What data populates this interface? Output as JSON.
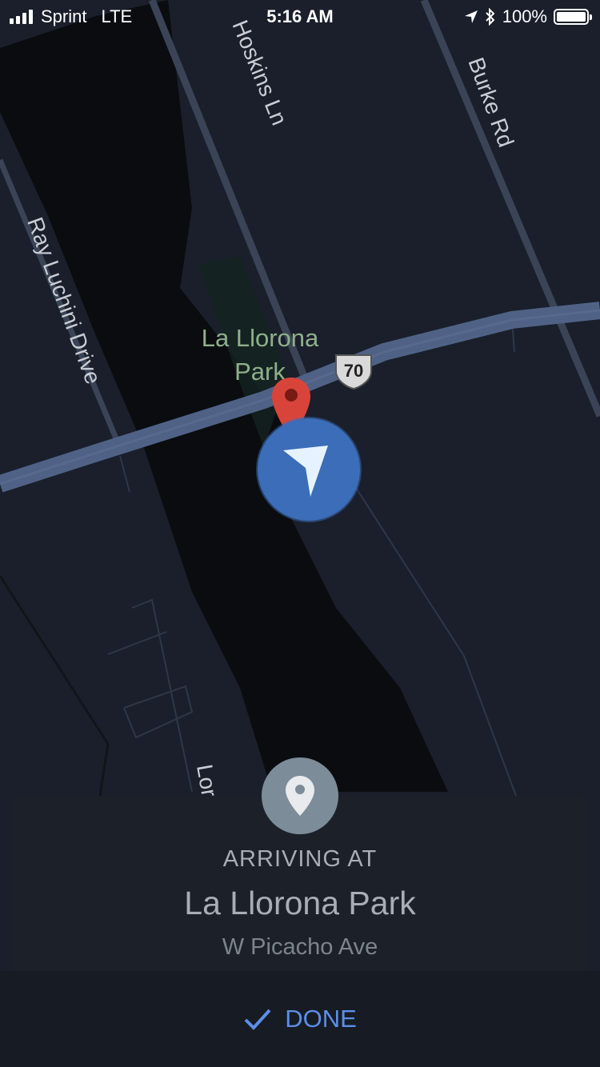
{
  "status_bar": {
    "carrier": "Sprint",
    "network": "LTE",
    "time": "5:16 AM",
    "battery": "100%"
  },
  "map": {
    "roads": {
      "ray_luchini": "Ray Luchini Drive",
      "hoskins": "Hoskins Ln",
      "burke": "Burke Rd",
      "partial": "Lor"
    },
    "park_name": "La Llorona Park",
    "highway_shield": "70",
    "colors": {
      "background": "#1a1f2b",
      "river": "#0a0c10",
      "highway": "#4f6286",
      "pin": "#d9443a",
      "puck": "#3b6db8"
    }
  },
  "destination_card": {
    "heading": "ARRIVING AT",
    "place_name": "La Llorona Park",
    "address": "W Picacho Ave",
    "icon": "location-pin-icon"
  },
  "footer": {
    "done_label": "DONE",
    "done_icon": "checkmark-icon"
  }
}
